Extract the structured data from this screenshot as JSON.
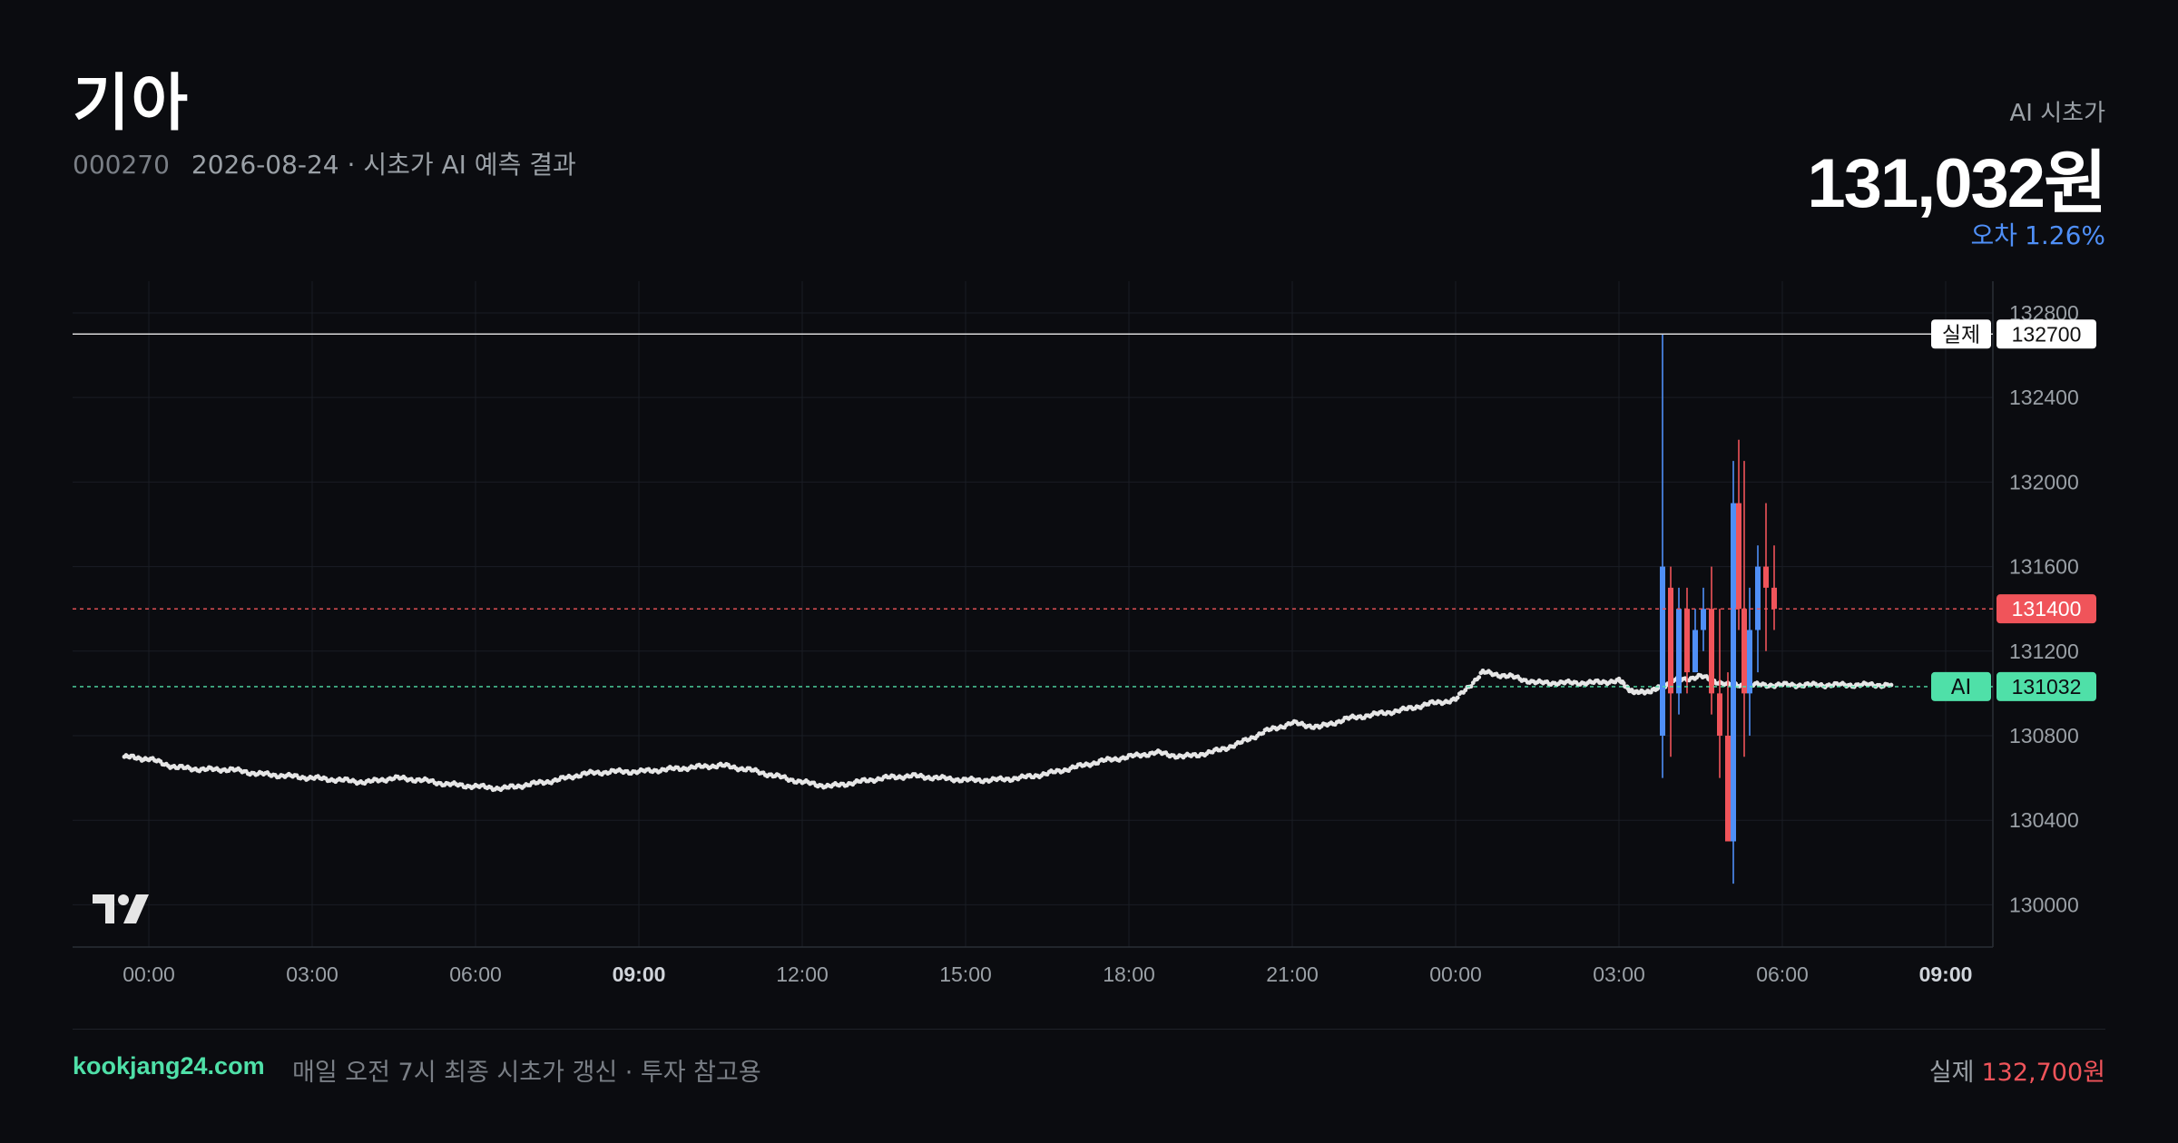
{
  "header": {
    "title": "기아",
    "code": "000270",
    "subtitle": "2026-08-24 · 시초가 AI 예측 결과"
  },
  "prediction": {
    "label": "AI 시초가",
    "value": "131,032원",
    "error_label": "오차",
    "error_value": "1.26%"
  },
  "footer": {
    "site": "kookjang24.com",
    "note": "매일 오전 7시 최종 시초가 갱신 · 투자 참고용",
    "actual_label": "실제",
    "actual_value": "132,700원"
  },
  "colors": {
    "background": "#0b0c10",
    "accent_green": "#4fe0a8",
    "accent_red": "#f0545a",
    "accent_blue": "#4f8ff7"
  },
  "icons": [
    "tradingview-logo-icon"
  ],
  "chart_data": {
    "type": "line",
    "ylim": [
      129800,
      132950
    ],
    "yticks": [
      130000,
      130400,
      130800,
      131200,
      131600,
      132000,
      132400,
      132800
    ],
    "xticks": [
      {
        "label": "00:00",
        "bold": false
      },
      {
        "label": "03:00",
        "bold": false
      },
      {
        "label": "06:00",
        "bold": false
      },
      {
        "label": "09:00",
        "bold": true
      },
      {
        "label": "12:00",
        "bold": false
      },
      {
        "label": "15:00",
        "bold": false
      },
      {
        "label": "18:00",
        "bold": false
      },
      {
        "label": "21:00",
        "bold": false
      },
      {
        "label": "00:00",
        "bold": false
      },
      {
        "label": "03:00",
        "bold": false
      },
      {
        "label": "06:00",
        "bold": false
      },
      {
        "label": "09:00",
        "bold": true
      }
    ],
    "grid": true,
    "reference_lines": [
      {
        "name": "실제",
        "value": 132700,
        "color": "#d9d9d9",
        "style": "solid",
        "badge_bg": "#ffffff",
        "badge_fg": "#111111"
      },
      {
        "name": "",
        "value": 131400,
        "color": "#f0545a",
        "style": "dashed",
        "badge_bg": "#f0545a",
        "badge_fg": "#ffffff"
      },
      {
        "name": "AI",
        "value": 131032,
        "color": "#4fe0a8",
        "style": "dashed",
        "badge_bg": "#4fe0a8",
        "badge_fg": "#0b0c10"
      }
    ],
    "series": [
      {
        "style": "dotted",
        "color": "#e6e6e6",
        "x": [
          -0.45,
          0.0,
          0.5,
          1.0,
          1.5,
          2.0,
          2.5,
          3.0,
          3.5,
          4.0,
          4.5,
          5.0,
          5.5,
          6.0,
          6.5,
          7.0,
          7.5,
          8.0,
          8.5,
          9.0,
          9.5,
          10.0,
          10.5,
          11.0,
          11.5,
          12.0,
          12.5,
          13.0,
          13.5,
          14.0,
          14.5,
          15.0,
          15.5,
          16.0,
          16.5,
          17.0,
          17.5,
          18.0,
          18.5,
          19.0,
          19.5,
          20.0,
          20.5,
          21.0,
          21.5,
          22.0,
          22.5,
          23.0,
          23.5,
          24.0,
          24.5,
          25.0,
          25.5,
          26.0,
          26.5,
          27.0,
          27.3,
          27.7,
          28.0,
          28.5,
          29.0,
          29.5,
          30.0,
          30.5,
          31.0,
          31.5,
          32.0
        ],
        "y": [
          130700,
          130690,
          130650,
          130640,
          130640,
          130620,
          130610,
          130600,
          130590,
          130580,
          130600,
          130590,
          130570,
          130560,
          130550,
          130570,
          130590,
          130620,
          130630,
          130630,
          130640,
          130650,
          130660,
          130640,
          130610,
          130580,
          130560,
          130580,
          130600,
          130610,
          130600,
          130590,
          130590,
          130600,
          130620,
          130650,
          130680,
          130700,
          130720,
          130700,
          130720,
          130760,
          130820,
          130860,
          130840,
          130880,
          130900,
          130920,
          130950,
          130970,
          131100,
          131080,
          131050,
          131050,
          131050,
          131060,
          131000,
          131020,
          131060,
          131080,
          131040,
          131040,
          131040,
          131040,
          131040,
          131040,
          131040
        ]
      },
      {
        "style": "candles",
        "candles": [
          {
            "x": 27.8,
            "o": 130800,
            "h": 132700,
            "l": 130600,
            "c": 131600
          },
          {
            "x": 27.95,
            "o": 131500,
            "h": 131600,
            "l": 130700,
            "c": 131000
          },
          {
            "x": 28.1,
            "o": 131000,
            "h": 131500,
            "l": 130900,
            "c": 131400
          },
          {
            "x": 28.25,
            "o": 131400,
            "h": 131500,
            "l": 131000,
            "c": 131100
          },
          {
            "x": 28.4,
            "o": 131100,
            "h": 131400,
            "l": 131100,
            "c": 131300
          },
          {
            "x": 28.55,
            "o": 131300,
            "h": 131500,
            "l": 131200,
            "c": 131400
          },
          {
            "x": 28.7,
            "o": 131400,
            "h": 131600,
            "l": 130900,
            "c": 131000
          },
          {
            "x": 28.85,
            "o": 131000,
            "h": 131400,
            "l": 130600,
            "c": 130800
          },
          {
            "x": 29.0,
            "o": 130800,
            "h": 131100,
            "l": 130300,
            "c": 130300
          },
          {
            "x": 29.1,
            "o": 130300,
            "h": 132100,
            "l": 130100,
            "c": 131900
          },
          {
            "x": 29.2,
            "o": 131900,
            "h": 132200,
            "l": 131300,
            "c": 131400
          },
          {
            "x": 29.3,
            "o": 131400,
            "h": 132100,
            "l": 130700,
            "c": 131000
          },
          {
            "x": 29.4,
            "o": 131000,
            "h": 131500,
            "l": 130800,
            "c": 131300
          },
          {
            "x": 29.55,
            "o": 131300,
            "h": 131700,
            "l": 131100,
            "c": 131600
          },
          {
            "x": 29.7,
            "o": 131600,
            "h": 131900,
            "l": 131200,
            "c": 131500
          },
          {
            "x": 29.85,
            "o": 131500,
            "h": 131700,
            "l": 131300,
            "c": 131400
          }
        ]
      }
    ]
  }
}
